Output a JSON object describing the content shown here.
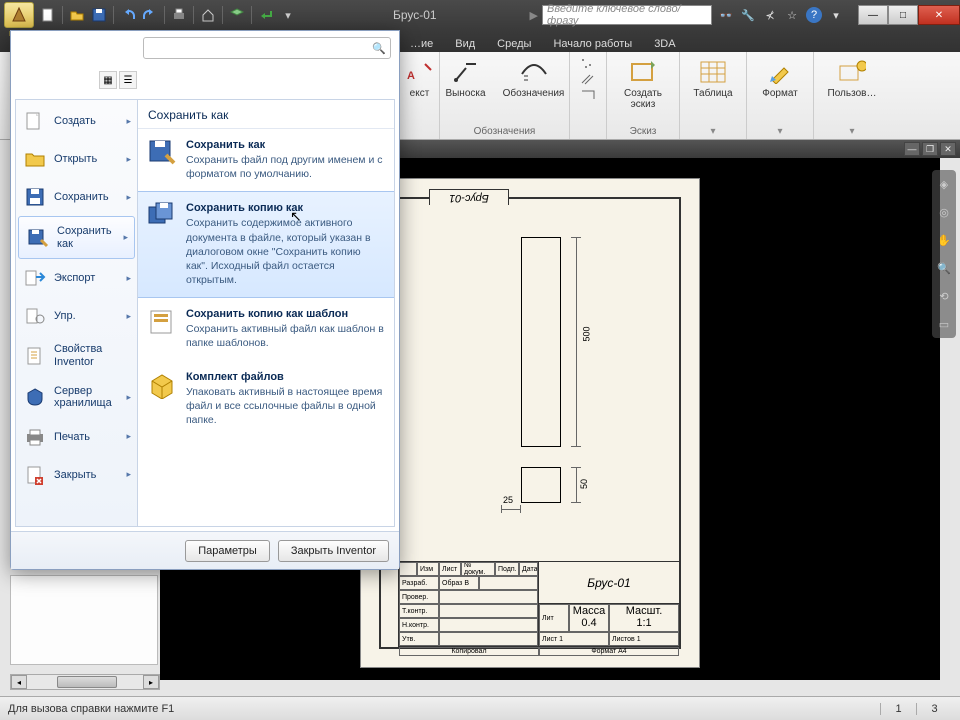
{
  "title_bar": {
    "doc_title": "Брус-01",
    "search_placeholder": "Введите ключевое слово/фразу"
  },
  "ribbon_tabs": [
    "…ие",
    "Вид",
    "Среды",
    "Начало работы",
    "3DA"
  ],
  "ribbon": {
    "group_annot": {
      "btn_leader": "Выноска",
      "btn_symbols": "Обозначения",
      "title": "Обозначения"
    },
    "group_sketch": {
      "btn_sketch": "Создать эскиз",
      "title": "Эскиз"
    },
    "group_table": {
      "btn": "Таблица"
    },
    "group_format": {
      "btn": "Формат"
    },
    "group_custom": {
      "btn": "Пользов…"
    },
    "group_text": {
      "stub": "екст"
    }
  },
  "app_menu": {
    "left_items": [
      {
        "label": "Создать",
        "icon": "new"
      },
      {
        "label": "Открыть",
        "icon": "open"
      },
      {
        "label": "Сохранить",
        "icon": "save"
      },
      {
        "label": "Сохранить как",
        "icon": "saveas",
        "active": true
      },
      {
        "label": "Экспорт",
        "icon": "export"
      },
      {
        "label": "Упр.",
        "icon": "manage"
      },
      {
        "label": "Свойства Inventor",
        "icon": "props"
      },
      {
        "label": "Сервер хранилища",
        "icon": "vault"
      },
      {
        "label": "Печать",
        "icon": "print"
      },
      {
        "label": "Закрыть",
        "icon": "close"
      }
    ],
    "panel_title": "Сохранить как",
    "options": [
      {
        "title": "Сохранить как",
        "desc": "Сохранить файл под другим именем и с форматом по умолчанию."
      },
      {
        "title": "Сохранить копию как",
        "desc": "Сохранить содержимое активного документа в файле, который указан в диалоговом окне \"Сохранить копию как\". Исходный файл остается открытым.",
        "selected": true
      },
      {
        "title": "Сохранить копию как шаблон",
        "desc": "Сохранить активный файл как шаблон в папке шаблонов."
      },
      {
        "title": "Комплект файлов",
        "desc": "Упаковать активный в настоящее время файл и все ссылочные файлы в одной папке."
      }
    ],
    "footer": {
      "params": "Параметры",
      "exit": "Закрыть Inventor"
    }
  },
  "drawing": {
    "sheet_tab": "Брус-01",
    "dim_main_height": "500",
    "dim_small_height": "50",
    "dim_small_width": "25",
    "titleblock_name": "Брус-01",
    "tb_headers": [
      "Изм",
      "Лист",
      "№ докум.",
      "Подп.",
      "Дата"
    ],
    "tb_roles": [
      "Разраб.",
      "Провер.",
      "Т.контр.",
      "",
      "Н.контр.",
      "Утв."
    ],
    "tb_author": "Образ В",
    "tb_cols_right": [
      "Лит",
      "Масса",
      "Масшт."
    ],
    "tb_scale": "1:1",
    "tb_mass": "0.4",
    "tb_sheet": "Лист 1",
    "tb_sheets": "Листов 1",
    "tb_bottom_left": "Копировал",
    "tb_bottom_right": "Формат А4"
  },
  "status": {
    "text": "Для вызова справки нажмите F1",
    "cell1": "1",
    "cell2": "3"
  }
}
